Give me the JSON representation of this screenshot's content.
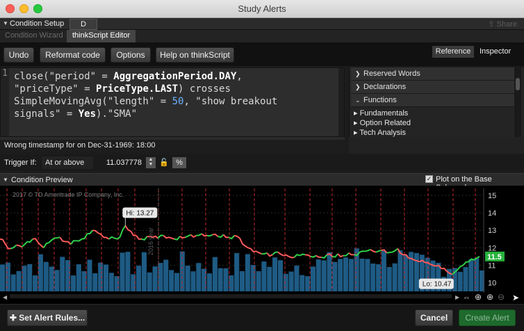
{
  "window": {
    "title": "Study Alerts"
  },
  "setup": {
    "label": "Condition Setup",
    "tab_label": "D",
    "share_label": "Share"
  },
  "subtabs": {
    "wizard": "Condition Wizard",
    "editor": "thinkScript Editor"
  },
  "toolbar": {
    "undo": "Undo",
    "reformat": "Reformat code",
    "options": "Options",
    "help": "Help on thinkScript",
    "reference": "Reference",
    "inspector": "Inspector"
  },
  "editor": {
    "line_number": "1",
    "code_parts": {
      "p1": "close(\"period\" = ",
      "p2": "AggregationPeriod.DAY",
      "p3": ",\n\"priceType\" = ",
      "p4": "PriceType.LAST",
      "p5": ") crosses\nSimpleMovingAvg(\"length\" = ",
      "p6": "50",
      "p7": ", \"show breakout\nsignals\" = ",
      "p8": "Yes",
      "p9": ").\"SMA\""
    }
  },
  "reference": {
    "headers": [
      "Reserved Words",
      "Declarations",
      "Functions"
    ],
    "items": [
      "Fundamentals",
      "Option Related",
      "Tech Analysis"
    ]
  },
  "warning": "Wrong timestamp for  on Dec-31-1969: 18:00",
  "trigger": {
    "label": "Trigger If:",
    "condition": "At or above",
    "value": "11.037778",
    "percent_label": "%"
  },
  "preview": {
    "label": "Condition Preview",
    "plot_base_label": "Plot on the Base Subgraph"
  },
  "chart_data": {
    "type": "line",
    "copyright": "2017 © TD Ameritrade IP Company, Inc.",
    "y_ticks": [
      "15",
      "14",
      "13",
      "12",
      "11",
      "10"
    ],
    "ylim": [
      9.5,
      15.4
    ],
    "hi_label": "Hi: 13.27",
    "lo_label": "Lo: 10.47",
    "last_price": "11.5",
    "year_label": "2016 year",
    "colors": {
      "up": "#2fd04a",
      "down": "#ff5a5a",
      "volume": "#1e5b84",
      "marker": "#c1272d"
    },
    "prices": [
      12.5,
      12.2,
      11.95,
      12.15,
      12.05,
      12.35,
      12.5,
      12.3,
      12.0,
      12.3,
      12.55,
      12.6,
      12.35,
      12.2,
      12.4,
      12.5,
      12.8,
      13.0,
      12.85,
      12.6,
      12.5,
      12.55,
      12.6,
      13.27,
      12.95,
      12.7,
      12.5,
      12.65,
      12.6,
      12.55,
      12.7,
      12.6,
      12.5,
      12.65,
      12.6,
      12.75,
      12.7,
      12.8,
      12.7,
      12.75,
      12.65,
      12.75,
      12.6,
      12.7,
      12.55,
      12.1,
      11.95,
      11.8,
      11.65,
      11.7,
      11.6,
      11.75,
      11.55,
      11.5,
      11.45,
      11.55,
      11.6,
      11.5,
      11.55,
      11.45,
      11.6,
      11.5,
      11.65,
      11.55,
      11.7,
      11.6,
      11.75,
      11.8,
      11.9,
      11.75,
      11.85,
      11.7,
      11.75,
      11.95,
      11.6,
      11.4,
      11.3,
      11.2,
      11.15,
      11.05,
      10.95,
      10.8,
      10.65,
      10.47,
      10.75,
      11.0,
      11.2,
      11.3,
      11.5
    ]
  },
  "bottom": {
    "set_rules": "Set Alert Rules...",
    "cancel": "Cancel",
    "create": "Create Alert"
  }
}
